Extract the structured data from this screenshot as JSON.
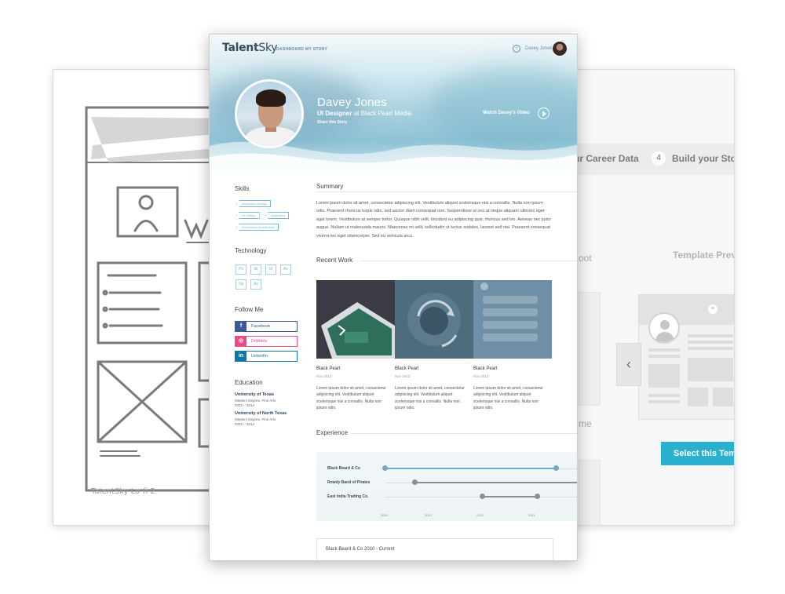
{
  "sketch": {
    "caption": "TalentSky Lo-fi 2"
  },
  "template_page": {
    "step3_label": "ur Career Data",
    "step4_number": "4",
    "step4_label": "Build your Sto",
    "boot_text": "oot",
    "preview_label": "Template Prev",
    "me_text": "me",
    "select_button": "Select this Temp"
  },
  "profile_page": {
    "logo": {
      "part1": "Talent",
      "part2": "Sky"
    },
    "nav": {
      "dashboard": "DASHBOARD",
      "my_story": "MY STORY"
    },
    "user": {
      "name": "Davey Jones"
    },
    "hero": {
      "name": "Davey Jones",
      "role_title": "UI Designer",
      "role_company": "at Black Pearl Media",
      "share": "Share this Story",
      "watch": "Watch Davey's Video"
    },
    "skills": {
      "heading": "Skills",
      "tags": [
        "Interaction Design",
        "UI Design",
        "Illustration",
        "Information Architecture"
      ]
    },
    "technology": {
      "heading": "Technology",
      "items": [
        "Ps",
        "Ai",
        "Id",
        "Ae",
        "Sg",
        "Au"
      ]
    },
    "follow": {
      "heading": "Follow Me",
      "links": [
        {
          "label": "Facebook",
          "icon": "f",
          "color": "#3b5998"
        },
        {
          "label": "Dribbble",
          "icon": "◎",
          "color": "#ea4c89"
        },
        {
          "label": "LinkedIn",
          "icon": "in",
          "color": "#0e76a8"
        }
      ]
    },
    "education": {
      "heading": "Education",
      "entries": [
        {
          "school": "University of Texas",
          "degree": "Masters Degree, Fine Arts",
          "years": "2012 – 2014"
        },
        {
          "school": "University of North Texas",
          "degree": "Masters Degree, Fine Arts",
          "years": "2012 – 2014"
        }
      ]
    },
    "summary": {
      "heading": "Summary",
      "text": "Lorem ipsum dolor sit amet, consectetur adipiscing elit. Vestibulum aliquet scelerisque nisi a convallis. Nulla non ipsum odio. Praesent rhoncus turpis odio, sed auctor diam consequat non. Suspendisse ut orci at neque aliquam ultricies eget eget lorem. Vestibulum at semper tortor. Quisque nibh velit, tincidunt eu adipiscing quis, rhoncus sed leo. Aenean nec justo augue. Nullam ut malesuada mauris. Maecenas mi velit, sollicitudin ut luctus sodales, laoreet sed nisi. Praesent consequat viverra leo eget ullamcorper. Sed eu vehicula arcu."
    },
    "recent_work": {
      "heading": "Recent Work",
      "items": [
        {
          "title": "Black Pearl",
          "date": "Nov 2013",
          "desc": "Lorem ipsum dolor sit amet, consectetur adipiscing elit. Vestibulum aliquet scelerisque nisi a convallis. Nulla non ipsum odio."
        },
        {
          "title": "Black Pearl",
          "date": "Nov 2013",
          "desc": "Lorem ipsum dolor sit amet, consectetur adipiscing elit. Vestibulum aliquet scelerisque nisi a convallis. Nulla non ipsum odio."
        },
        {
          "title": "Black Pearl",
          "date": "Nov 2013",
          "desc": "Lorem ipsum dolor sit amet, consectetur adipiscing elit. Vestibulum aliquet scelerisque nisi a convallis. Nulla non ipsum odio."
        }
      ]
    },
    "experience": {
      "heading": "Experience",
      "rows": [
        {
          "label": "Black Beard & Co",
          "color": "#6fa8c8"
        },
        {
          "label": "Rowdy Band of Pirates",
          "color": "#8a8f93"
        },
        {
          "label": "East India Trading Co.",
          "color": "#8a8f93"
        }
      ],
      "years": [
        "2014",
        "2013",
        "2012",
        "2011"
      ],
      "card_text": "Black Beard & Co 2010 - Current"
    }
  }
}
